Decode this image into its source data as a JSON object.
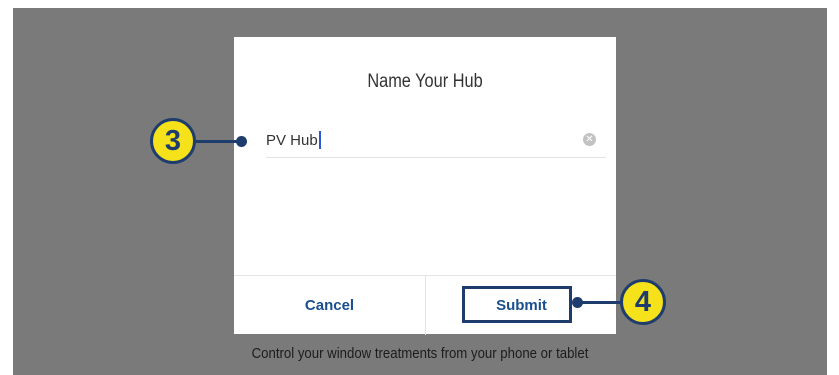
{
  "dialog": {
    "title": "Name Your Hub",
    "name_field": {
      "value": "PV Hub"
    },
    "buttons": {
      "cancel_label": "Cancel",
      "submit_label": "Submit"
    }
  },
  "caption": "Control your window treatments from your phone or tablet",
  "callouts": {
    "name_field_step": "3",
    "submit_step": "4"
  },
  "colors": {
    "backdrop": "#7a7a7a",
    "button_text": "#1a4f8f",
    "callout_fill": "#f5e21a",
    "callout_outline": "#1e3d6d",
    "caret": "#2a56d8"
  },
  "icons": {
    "clear": "clear-circle-x-icon"
  }
}
